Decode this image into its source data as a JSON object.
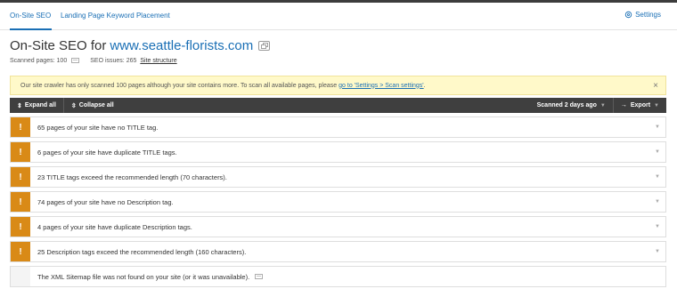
{
  "tabs": [
    {
      "label": "On-Site SEO",
      "active": true
    },
    {
      "label": "Landing Page Keyword Placement",
      "active": false
    }
  ],
  "settings_label": "Settings",
  "title": {
    "prefix": "On-Site SEO for",
    "domain": "www.seattle-florists.com"
  },
  "meta": {
    "scanned_pages": "Scanned pages: 100",
    "seo_issues": "SEO issues: 265",
    "site_structure_link": "Site structure"
  },
  "notice": {
    "text": "Our site crawler has only scanned 100 pages although your site contains more. To scan all available pages, please",
    "link": "go to 'Settings > Scan settings'",
    "after": ".",
    "close": "×"
  },
  "toolbar": {
    "expand_all": "Expand all",
    "collapse_all": "Collapse all",
    "scanned": "Scanned 2 days ago",
    "export": "Export"
  },
  "issues": [
    {
      "badge": "!",
      "text": "65 pages of your site have no TITLE tag.",
      "severity": "warning"
    },
    {
      "badge": "!",
      "text": "6 pages of your site have duplicate TITLE tags.",
      "severity": "warning"
    },
    {
      "badge": "!",
      "text": "23 TITLE tags exceed the recommended length (70 characters).",
      "severity": "warning"
    },
    {
      "badge": "!",
      "text": "74 pages of your site have no Description tag.",
      "severity": "warning"
    },
    {
      "badge": "!",
      "text": "4 pages of your site have duplicate Description tags.",
      "severity": "warning"
    },
    {
      "badge": "!",
      "text": "25 Description tags exceed the recommended length (160 characters).",
      "severity": "warning"
    },
    {
      "badge": "",
      "text": "The XML Sitemap file was not found on your site (or it was unavailable).",
      "severity": "neutral"
    }
  ],
  "colors": {
    "accent": "#1a6fb5",
    "warning": "#d98a17",
    "toolbar": "#3f3f3f",
    "notice_bg": "#fff9c9"
  }
}
